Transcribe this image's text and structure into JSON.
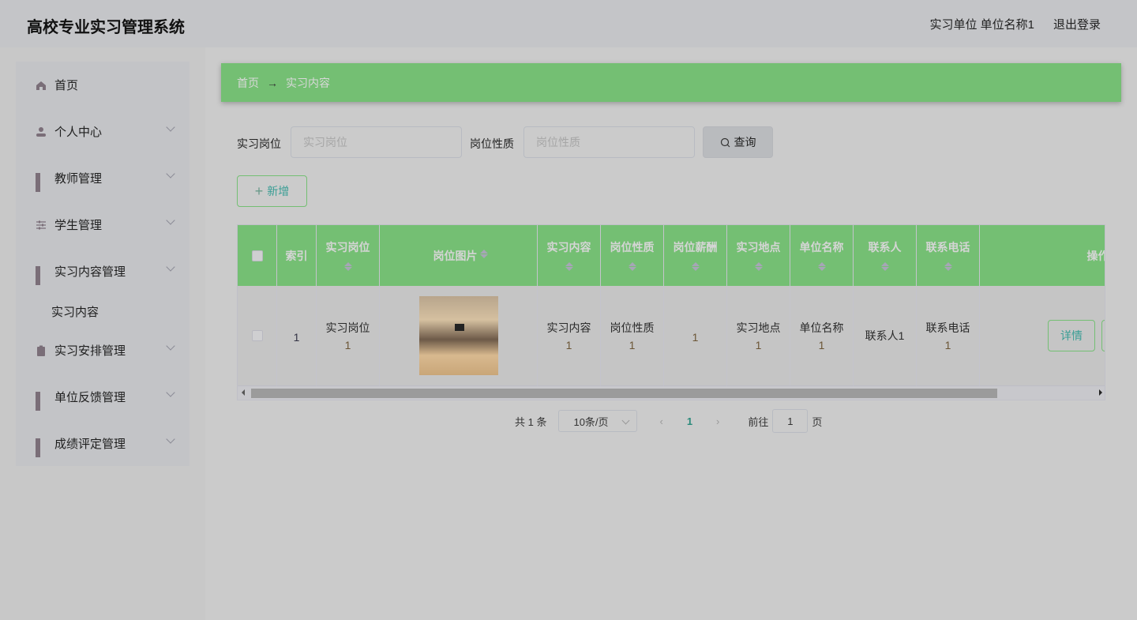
{
  "header": {
    "title": "高校专业实习管理系统",
    "user": "实习单位 单位名称1",
    "logout": "退出登录"
  },
  "sidebar": {
    "items": [
      {
        "label": "首页",
        "icon": "home-icon"
      },
      {
        "label": "个人中心",
        "icon": "user-icon"
      },
      {
        "label": "教师管理",
        "icon": "grid-icon"
      },
      {
        "label": "学生管理",
        "icon": "sliders-icon"
      },
      {
        "label": "实习内容管理",
        "icon": "grid-icon"
      },
      {
        "label": "实习安排管理",
        "icon": "clipboard-icon"
      },
      {
        "label": "单位反馈管理",
        "icon": "grid-icon"
      },
      {
        "label": "成绩评定管理",
        "icon": "grid-icon"
      }
    ],
    "sub_item": "实习内容"
  },
  "breadcrumb": {
    "home": "首页",
    "arrow": "→",
    "current": "实习内容"
  },
  "search": {
    "field1_label": "实习岗位",
    "field1_placeholder": "实习岗位",
    "field2_label": "岗位性质",
    "field2_placeholder": "岗位性质",
    "query": "查询"
  },
  "add_label": "新增",
  "table": {
    "headers": [
      "索引",
      "实习岗位",
      "岗位图片",
      "实习内容",
      "岗位性质",
      "岗位薪酬",
      "实习地点",
      "单位名称",
      "联系人",
      "联系电话",
      "操作"
    ],
    "row": {
      "index": "1",
      "post": "实习岗位",
      "post_n": "1",
      "content": "实习内容",
      "content_n": "1",
      "nature": "岗位性质",
      "nature_n": "1",
      "salary": "1",
      "place": "实习地点",
      "place_n": "1",
      "unit": "单位名称",
      "unit_n": "1",
      "contact": "联系人1",
      "phone": "联系电话",
      "phone_n": "1",
      "detail": "详情"
    }
  },
  "pagination": {
    "total": "共 1 条",
    "page_size": "10条/页",
    "current": "1",
    "goto": "前往",
    "goto_value": "1",
    "page_suffix": "页"
  }
}
